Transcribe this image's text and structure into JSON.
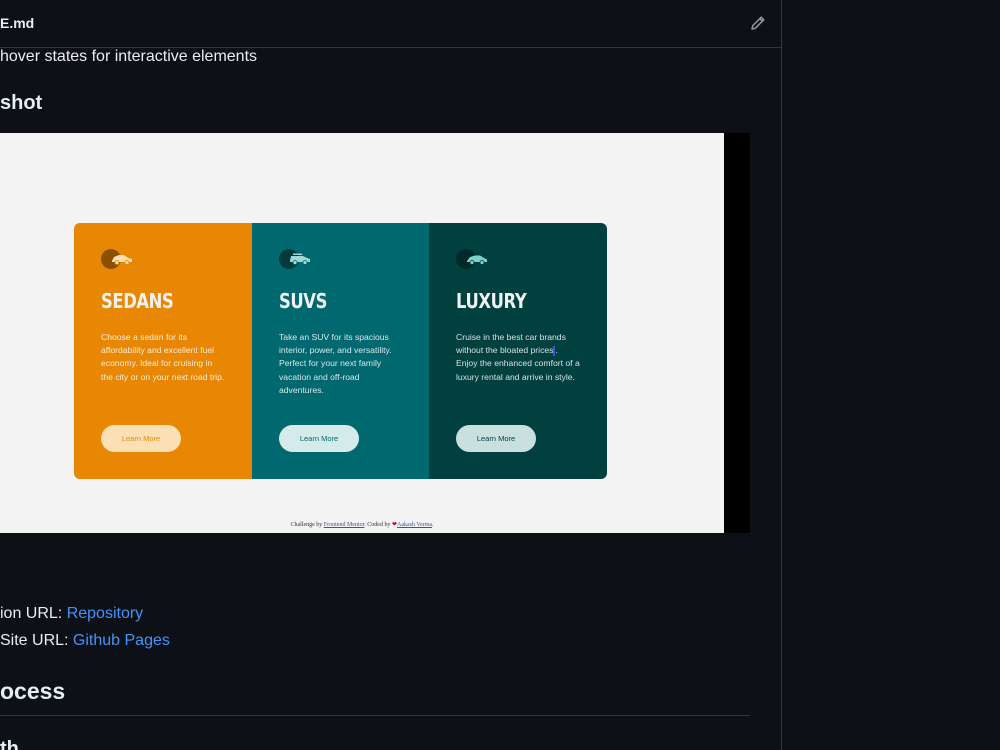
{
  "file": {
    "name": "E.md"
  },
  "readme": {
    "bullet_text": "hover states for interactive elements",
    "screenshot_heading": "shot",
    "repo_prefix": "ion URL: ",
    "repo_link": "Repository",
    "site_prefix": "Site URL: ",
    "site_link": "Github Pages",
    "process_heading": "ocess",
    "next_heading": "th"
  },
  "screenshot": {
    "cards": [
      {
        "title": "SEDANS",
        "text": "Choose a sedan for its affordability and excellent fuel economy. Ideal for cruising in the city or on your next road trip.",
        "button": "Learn More",
        "color": "#e88703",
        "icon": "sedan-car-icon"
      },
      {
        "title": "SUVS",
        "text": "Take an SUV for its spacious interior, power, and versatility. Perfect for your next family vacation and off-road adventures.",
        "button": "Learn More",
        "color": "#006970",
        "icon": "suv-car-icon"
      },
      {
        "title": "LUXURY",
        "text_before_cursor": "Cruise in the best car brands without the bloated prices",
        "text_after_cursor": ". Enjoy the enhanced comfort of a luxury rental and arrive in style.",
        "button": "Learn More",
        "color": "#004140",
        "icon": "luxury-car-icon"
      }
    ],
    "attribution": {
      "prefix": "Challenge by ",
      "link1": "Frontend Mentor",
      "middle": ". Coded by ",
      "link2": "Aakash Verma",
      "suffix": "."
    }
  },
  "colors": {
    "background": "#0d1117",
    "link": "#4493f8",
    "border": "#30363d"
  }
}
